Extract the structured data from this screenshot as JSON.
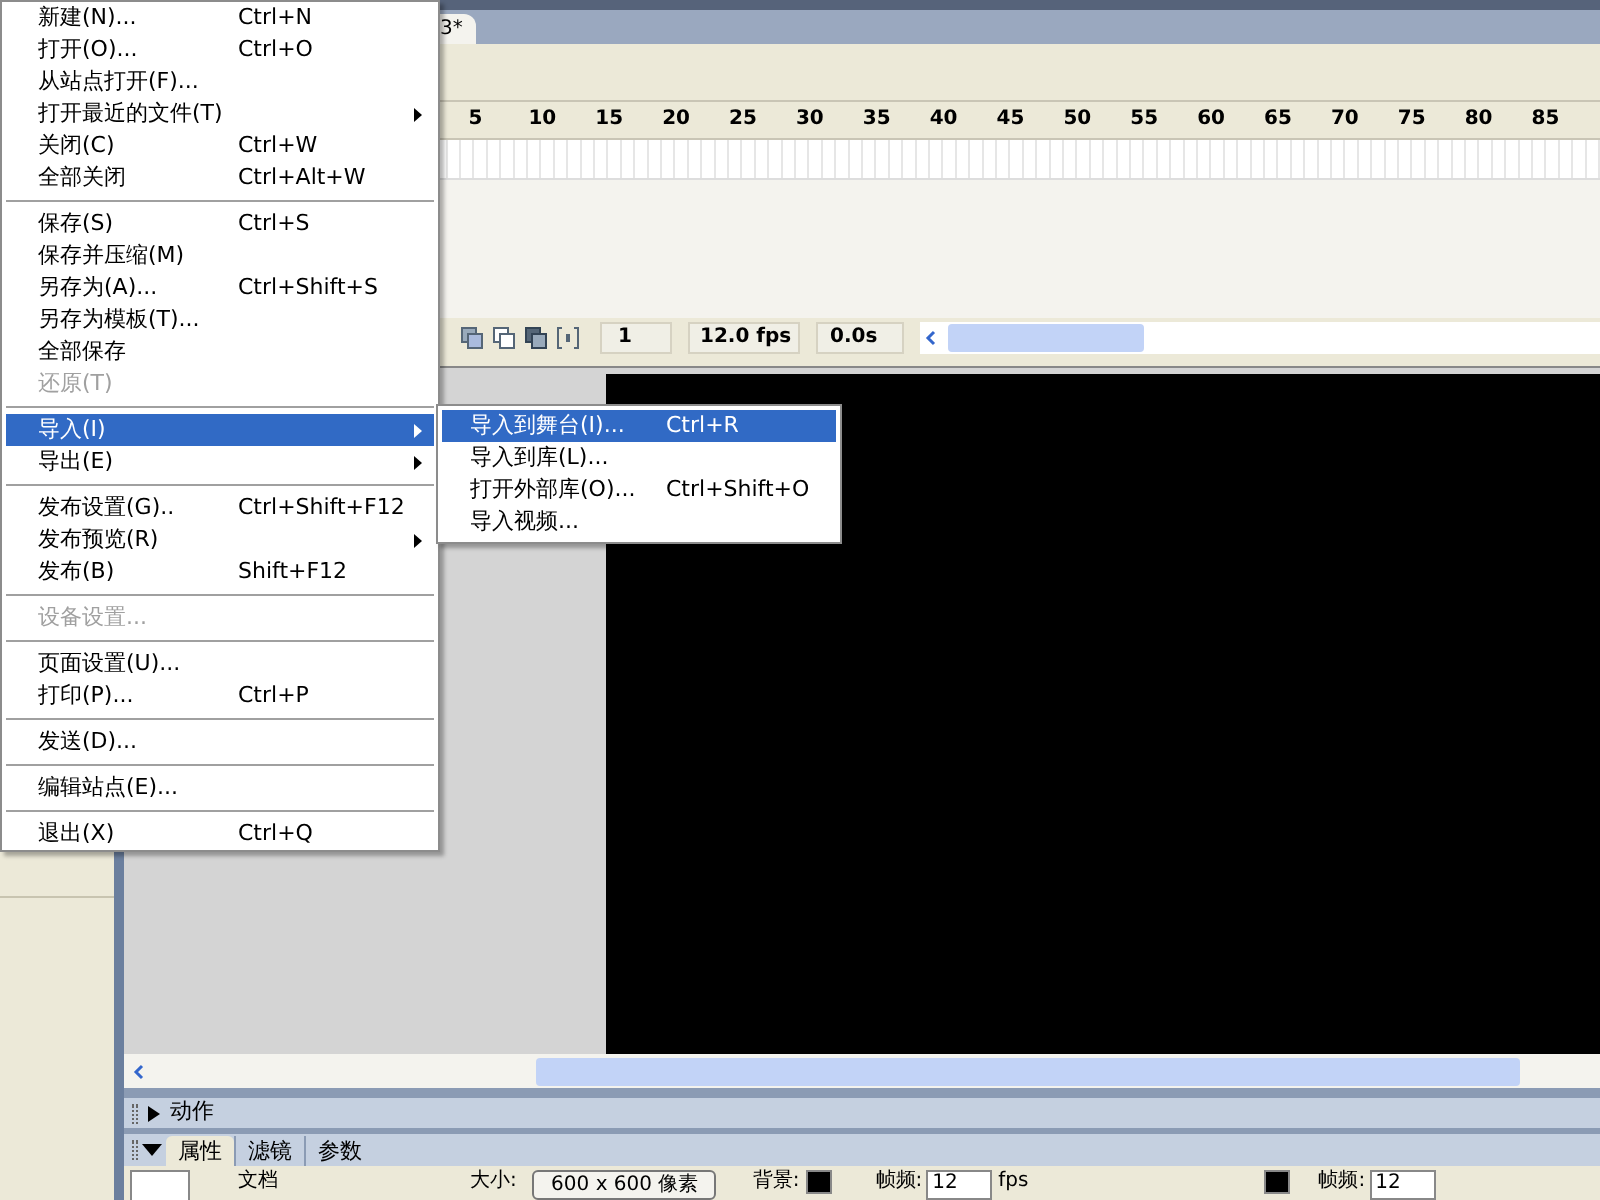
{
  "document_tab": {
    "label": "3*"
  },
  "timeline": {
    "ruler": [
      "5",
      "10",
      "15",
      "20",
      "25",
      "30",
      "35",
      "40",
      "45",
      "50",
      "55",
      "60",
      "65",
      "70",
      "75",
      "80",
      "85"
    ],
    "current_frame": "1",
    "frame_rate": "12.0 fps",
    "elapsed": "0.0s"
  },
  "file_menu": {
    "items": [
      {
        "kind": "item",
        "label": "新建(N)...",
        "shortcut": "Ctrl+N",
        "disabled": false,
        "submenu": false,
        "selected": false
      },
      {
        "kind": "item",
        "label": "打开(O)...",
        "shortcut": "Ctrl+O",
        "disabled": false,
        "submenu": false,
        "selected": false
      },
      {
        "kind": "item",
        "label": "从站点打开(F)...",
        "disabled": false,
        "submenu": false,
        "selected": false
      },
      {
        "kind": "item",
        "label": "打开最近的文件(T)",
        "disabled": false,
        "submenu": true,
        "selected": false
      },
      {
        "kind": "item",
        "label": "关闭(C)",
        "shortcut": "Ctrl+W",
        "disabled": false,
        "submenu": false,
        "selected": false
      },
      {
        "kind": "item",
        "label": "全部关闭",
        "shortcut": "Ctrl+Alt+W",
        "disabled": false,
        "submenu": false,
        "selected": false
      },
      {
        "kind": "separator"
      },
      {
        "kind": "item",
        "label": "保存(S)",
        "shortcut": "Ctrl+S",
        "disabled": false,
        "submenu": false,
        "selected": false
      },
      {
        "kind": "item",
        "label": "保存并压缩(M)",
        "disabled": false,
        "submenu": false,
        "selected": false
      },
      {
        "kind": "item",
        "label": "另存为(A)...",
        "shortcut": "Ctrl+Shift+S",
        "disabled": false,
        "submenu": false,
        "selected": false
      },
      {
        "kind": "item",
        "label": "另存为模板(T)...",
        "disabled": false,
        "submenu": false,
        "selected": false
      },
      {
        "kind": "item",
        "label": "全部保存",
        "disabled": false,
        "submenu": false,
        "selected": false
      },
      {
        "kind": "item",
        "label": "还原(T)",
        "disabled": true,
        "submenu": false,
        "selected": false
      },
      {
        "kind": "separator"
      },
      {
        "kind": "item",
        "label": "导入(I)",
        "disabled": false,
        "submenu": true,
        "selected": true
      },
      {
        "kind": "item",
        "label": "导出(E)",
        "disabled": false,
        "submenu": true,
        "selected": false
      },
      {
        "kind": "separator"
      },
      {
        "kind": "item",
        "label": "发布设置(G)..",
        "shortcut": "Ctrl+Shift+F12",
        "disabled": false,
        "submenu": false,
        "selected": false
      },
      {
        "kind": "item",
        "label": "发布预览(R)",
        "disabled": false,
        "submenu": true,
        "selected": false
      },
      {
        "kind": "item",
        "label": "发布(B)",
        "shortcut": "Shift+F12",
        "disabled": false,
        "submenu": false,
        "selected": false
      },
      {
        "kind": "separator"
      },
      {
        "kind": "item",
        "label": "设备设置...",
        "disabled": true,
        "submenu": false,
        "selected": false
      },
      {
        "kind": "separator"
      },
      {
        "kind": "item",
        "label": "页面设置(U)...",
        "disabled": false,
        "submenu": false,
        "selected": false
      },
      {
        "kind": "item",
        "label": "打印(P)...",
        "shortcut": "Ctrl+P",
        "disabled": false,
        "submenu": false,
        "selected": false
      },
      {
        "kind": "separator"
      },
      {
        "kind": "item",
        "label": "发送(D)...",
        "disabled": false,
        "submenu": false,
        "selected": false
      },
      {
        "kind": "separator"
      },
      {
        "kind": "item",
        "label": "编辑站点(E)...",
        "disabled": false,
        "submenu": false,
        "selected": false
      },
      {
        "kind": "separator"
      },
      {
        "kind": "item",
        "label": "退出(X)",
        "shortcut": "Ctrl+Q",
        "disabled": false,
        "submenu": false,
        "selected": false
      }
    ]
  },
  "import_submenu": {
    "items": [
      {
        "label": "导入到舞台(I)...",
        "shortcut": "Ctrl+R",
        "selected": true
      },
      {
        "label": "导入到库(L)...",
        "selected": false
      },
      {
        "label": "打开外部库(O)...",
        "shortcut": "Ctrl+Shift+O",
        "selected": false
      },
      {
        "label": "导入视频...",
        "selected": false
      }
    ]
  },
  "actions_panel": {
    "title": "动作",
    "expanded": false
  },
  "properties_panel": {
    "expanded": true,
    "tabs": [
      {
        "label": "属性",
        "selected": true
      },
      {
        "label": "滤镜",
        "selected": false
      },
      {
        "label": "参数",
        "selected": false
      }
    ],
    "document_label": "文档",
    "size_label": "大小:",
    "size_button": "600 x 600 像素",
    "background_label": "背景:",
    "frame_rate_label": "帧频:",
    "frame_rate_value": "12",
    "fps_unit": "fps",
    "frame_rate_label_2": "帧频:",
    "frame_rate_value_2": "12"
  }
}
